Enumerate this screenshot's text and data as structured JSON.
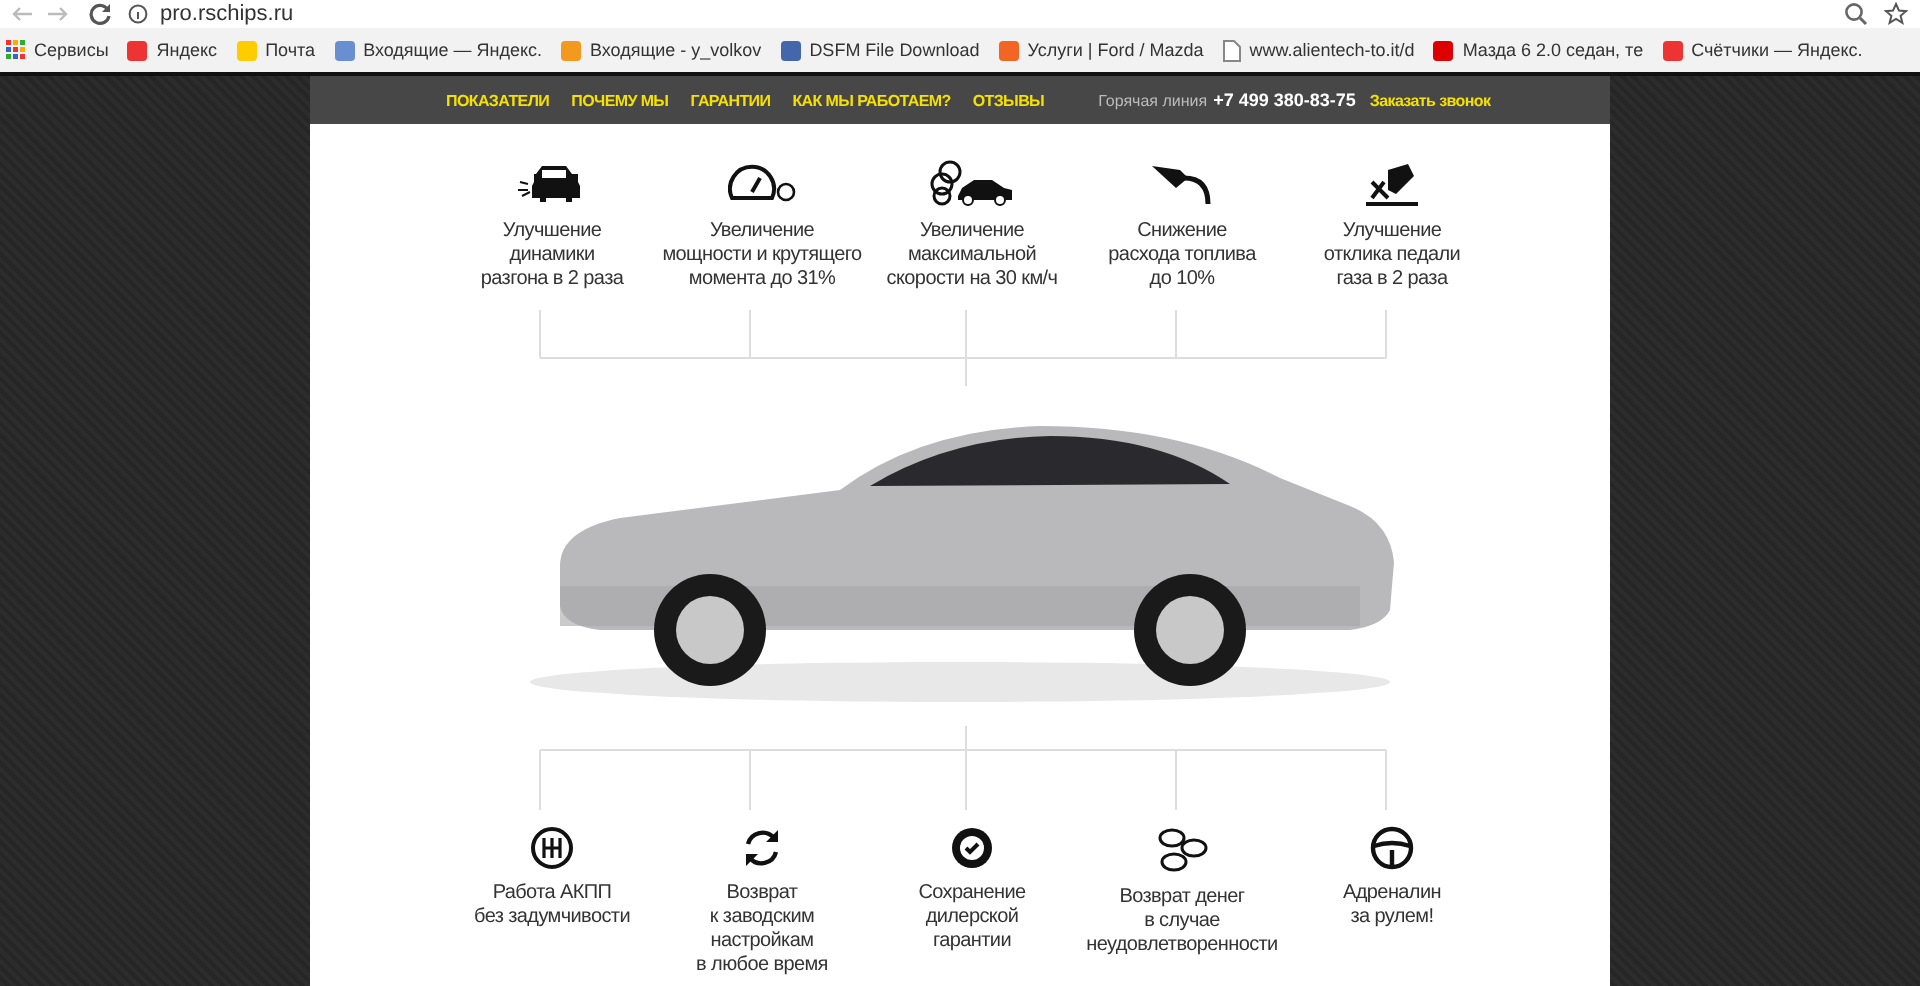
{
  "browser": {
    "url": "pro.rschips.ru",
    "bookmarks": [
      {
        "kind": "apps",
        "label": "Сервисы"
      },
      {
        "kind": "yandex",
        "label": "Яндекс"
      },
      {
        "kind": "mail",
        "label": "Почта"
      },
      {
        "kind": "envelope",
        "label": "Входящие — Яндекс."
      },
      {
        "kind": "at",
        "label": "Входящие - y_volkov"
      },
      {
        "kind": "flag",
        "label": "DSFM File Download"
      },
      {
        "kind": "orange",
        "label": "Услуги | Ford / Mazda"
      },
      {
        "kind": "page",
        "label": "www.alientech-to.it/d"
      },
      {
        "kind": "red",
        "label": "Мазда 6 2.0 седан, те"
      },
      {
        "kind": "yandex",
        "label": "Счётчики — Яндекс."
      }
    ]
  },
  "header": {
    "nav": [
      "ПОКАЗАТЕЛИ",
      "ПОЧЕМУ МЫ",
      "ГАРАНТИИ",
      "КАК МЫ РАБОТАЕМ?",
      "ОТЗЫВЫ"
    ],
    "hotline_label": "Горячая линия",
    "phone": "+7 499 380-83-75",
    "callback": "Заказать звонок"
  },
  "top_features": [
    {
      "kind": "car-front",
      "label": "Улучшение\nдинамики\nразгона в 2 раза"
    },
    {
      "kind": "speedometer",
      "label": "Увеличение\nмощности и крутящего\nмомента до 31%"
    },
    {
      "kind": "car-smoke",
      "label": "Увеличение\nмаксимальной\nскорости на 30 км/ч"
    },
    {
      "kind": "fuel-nozzle",
      "label": "Снижение\nрасхода топлива\nдо 10%"
    },
    {
      "kind": "pedal",
      "label": "Улучшение\nотклика педали\nгаза в 2 раза"
    }
  ],
  "bottom_features": [
    {
      "kind": "gearbox",
      "label": "Работа АКПП\nбез задумчивости"
    },
    {
      "kind": "refresh",
      "label": "Возврат\nк заводским\nнастройкам\nв любое время"
    },
    {
      "kind": "seal",
      "label": "Сохранение\nдилерской\nгарантии"
    },
    {
      "kind": "coins",
      "label": "Возврат денег\nв случае\nнеудовлетворенности"
    },
    {
      "kind": "wheel",
      "label": "Адреналин\nза рулем!"
    }
  ]
}
